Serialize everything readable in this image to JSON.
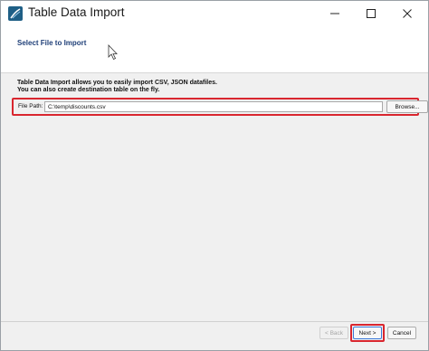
{
  "window": {
    "title": "Table Data Import",
    "controls": {
      "minimize": "minimize-icon",
      "maximize": "maximize-icon",
      "close": "close-icon"
    }
  },
  "header": {
    "title": "Select File to Import"
  },
  "content": {
    "description_line1": "Table Data Import allows you to easily import CSV, JSON datafiles.",
    "description_line2": "You can also create destination table on the fly.",
    "file_path_label": "File Path:",
    "file_path_value": "C:\\temp\\discounts.csv",
    "browse_label": "Browse..."
  },
  "footer": {
    "back_label": "< Back",
    "next_label": "Next >",
    "cancel_label": "Cancel"
  },
  "colors": {
    "highlight": "#d9262f",
    "header_title": "#1f3f78",
    "app_icon": "#1f5f86"
  }
}
